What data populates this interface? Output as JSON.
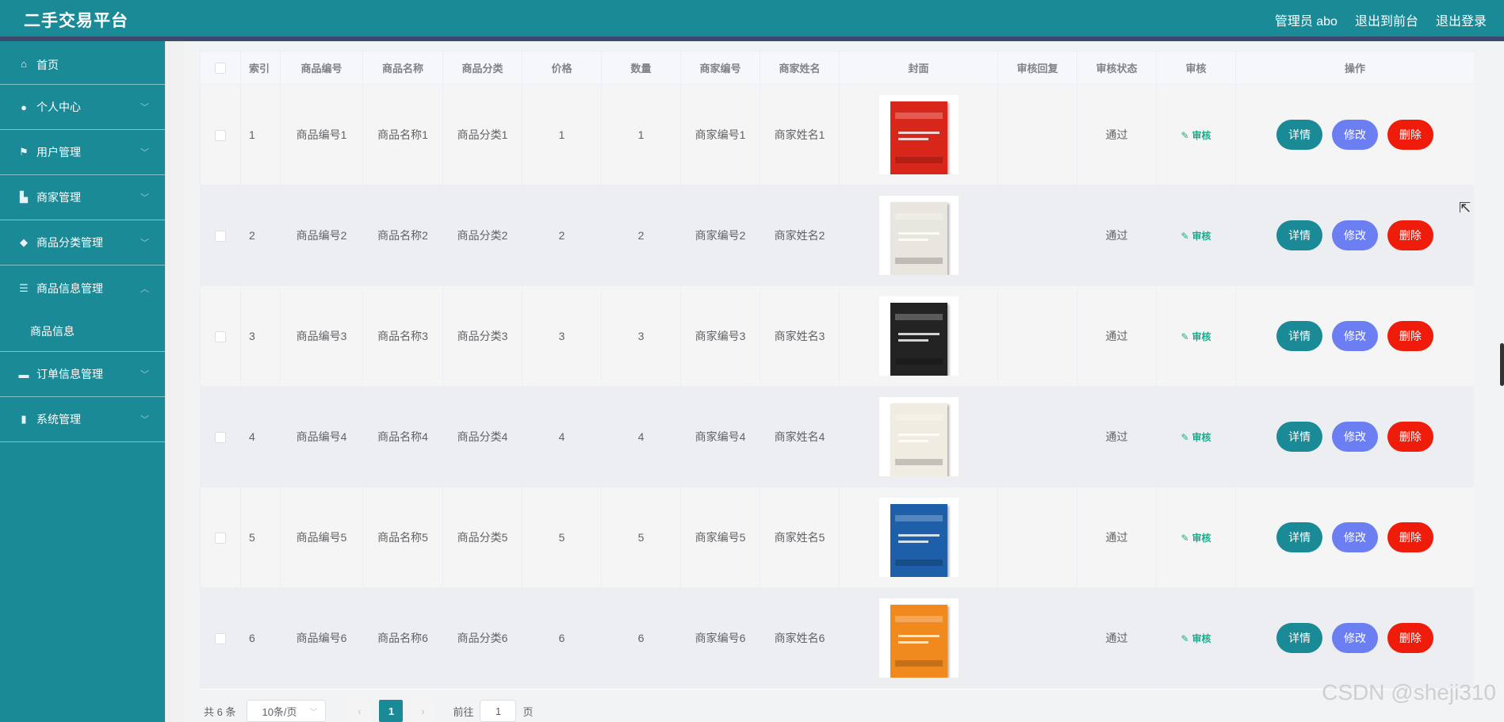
{
  "header": {
    "brand": "二手交易平台",
    "admin_label": "管理员 abo",
    "to_front": "退出到前台",
    "logout": "退出登录"
  },
  "sidebar": {
    "items": [
      {
        "label": "首页",
        "icon": "home-icon"
      },
      {
        "label": "个人中心",
        "icon": "user-icon"
      },
      {
        "label": "用户管理",
        "icon": "flag-icon"
      },
      {
        "label": "商家管理",
        "icon": "store-icon"
      },
      {
        "label": "商品分类管理",
        "icon": "location-icon"
      },
      {
        "label": "商品信息管理",
        "icon": "list-icon"
      },
      {
        "label": "商品信息",
        "icon": ""
      },
      {
        "label": "订单信息管理",
        "icon": "briefcase-icon"
      },
      {
        "label": "系统管理",
        "icon": "chart-icon"
      }
    ]
  },
  "table": {
    "headers": [
      "",
      "索引",
      "商品编号",
      "商品名称",
      "商品分类",
      "价格",
      "数量",
      "商家编号",
      "商家姓名",
      "封面",
      "审核回复",
      "审核状态",
      "审核",
      "操作"
    ],
    "audit_link_label": "审核",
    "btn_detail": "详情",
    "btn_edit": "修改",
    "btn_delete": "删除",
    "rows": [
      {
        "index": "1",
        "code": "商品编号1",
        "name": "商品名称1",
        "category": "商品分类1",
        "price": "1",
        "qty": "1",
        "merchant_code": "商家编号1",
        "merchant_name": "商家姓名1",
        "reply": "",
        "status": "通过",
        "cover_color": "#d8261b"
      },
      {
        "index": "2",
        "code": "商品编号2",
        "name": "商品名称2",
        "category": "商品分类2",
        "price": "2",
        "qty": "2",
        "merchant_code": "商家编号2",
        "merchant_name": "商家姓名2",
        "reply": "",
        "status": "通过",
        "cover_color": "#e9e6df"
      },
      {
        "index": "3",
        "code": "商品编号3",
        "name": "商品名称3",
        "category": "商品分类3",
        "price": "3",
        "qty": "3",
        "merchant_code": "商家编号3",
        "merchant_name": "商家姓名3",
        "reply": "",
        "status": "通过",
        "cover_color": "#232323"
      },
      {
        "index": "4",
        "code": "商品编号4",
        "name": "商品名称4",
        "category": "商品分类4",
        "price": "4",
        "qty": "4",
        "merchant_code": "商家编号4",
        "merchant_name": "商家姓名4",
        "reply": "",
        "status": "通过",
        "cover_color": "#f1ece2"
      },
      {
        "index": "5",
        "code": "商品编号5",
        "name": "商品名称5",
        "category": "商品分类5",
        "price": "5",
        "qty": "5",
        "merchant_code": "商家编号5",
        "merchant_name": "商家姓名5",
        "reply": "",
        "status": "通过",
        "cover_color": "#1d5fa8"
      },
      {
        "index": "6",
        "code": "商品编号6",
        "name": "商品名称6",
        "category": "商品分类6",
        "price": "6",
        "qty": "6",
        "merchant_code": "商家编号6",
        "merchant_name": "商家姓名6",
        "reply": "",
        "status": "通过",
        "cover_color": "#f08a1f"
      }
    ]
  },
  "pagination": {
    "total": "共 6 条",
    "page_size": "10条/页",
    "current_page": "1",
    "goto_prefix": "前往",
    "goto_value": "1",
    "goto_suffix": "页"
  },
  "watermark": "CSDN @sheji310"
}
